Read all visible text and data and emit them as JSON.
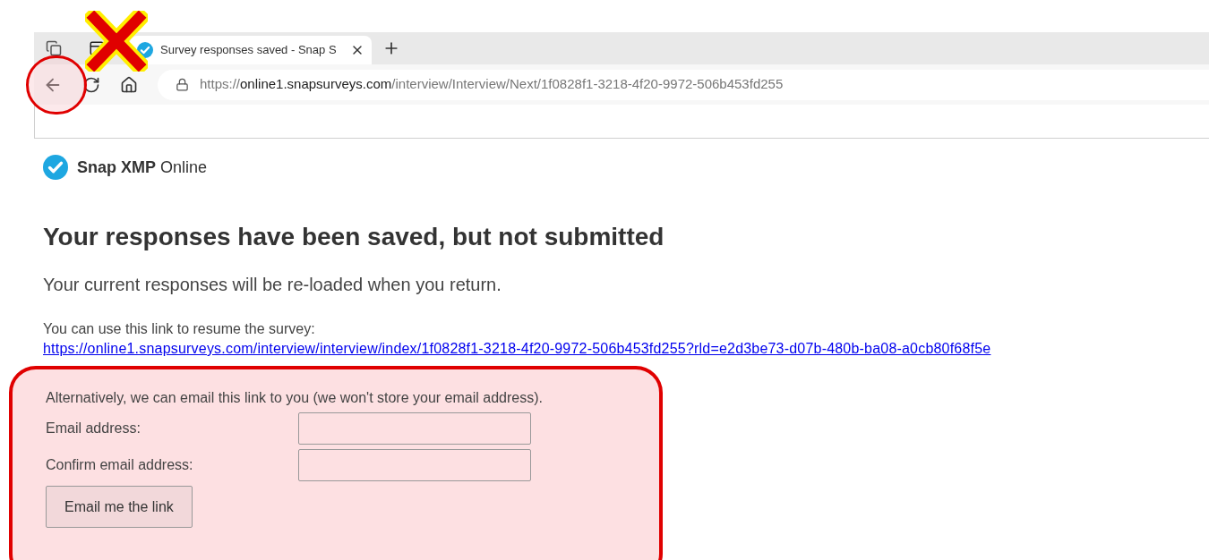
{
  "browser": {
    "tab": {
      "title": "Survey responses saved - Snap S",
      "selected": true
    },
    "url": {
      "scheme": "https://",
      "host": "online1.snapsurveys.com",
      "path": "/interview/Interview/Next/1f0828f1-3218-4f20-9972-506b453fd255"
    }
  },
  "brand": "**Snap XMP** Online",
  "heading": "Your responses have been saved, but not submitted",
  "intro": "Your current responses will be re-loaded when you return.",
  "resume": {
    "label": "You can use this link to resume the survey:",
    "link": "https://online1.snapsurveys.com/interview/interview/index/1f0828f1-3218-4f20-9972-506b453fd255?rld=e2d3be73-d07b-480b-ba08-a0cb80f68f5e"
  },
  "email_form": {
    "note": "Alternatively, we can email this link to you (we won't store your email address).",
    "fields": [
      {
        "label": "Email address:"
      },
      {
        "label": "Confirm email address:"
      }
    ],
    "button": "Email me the link"
  }
}
